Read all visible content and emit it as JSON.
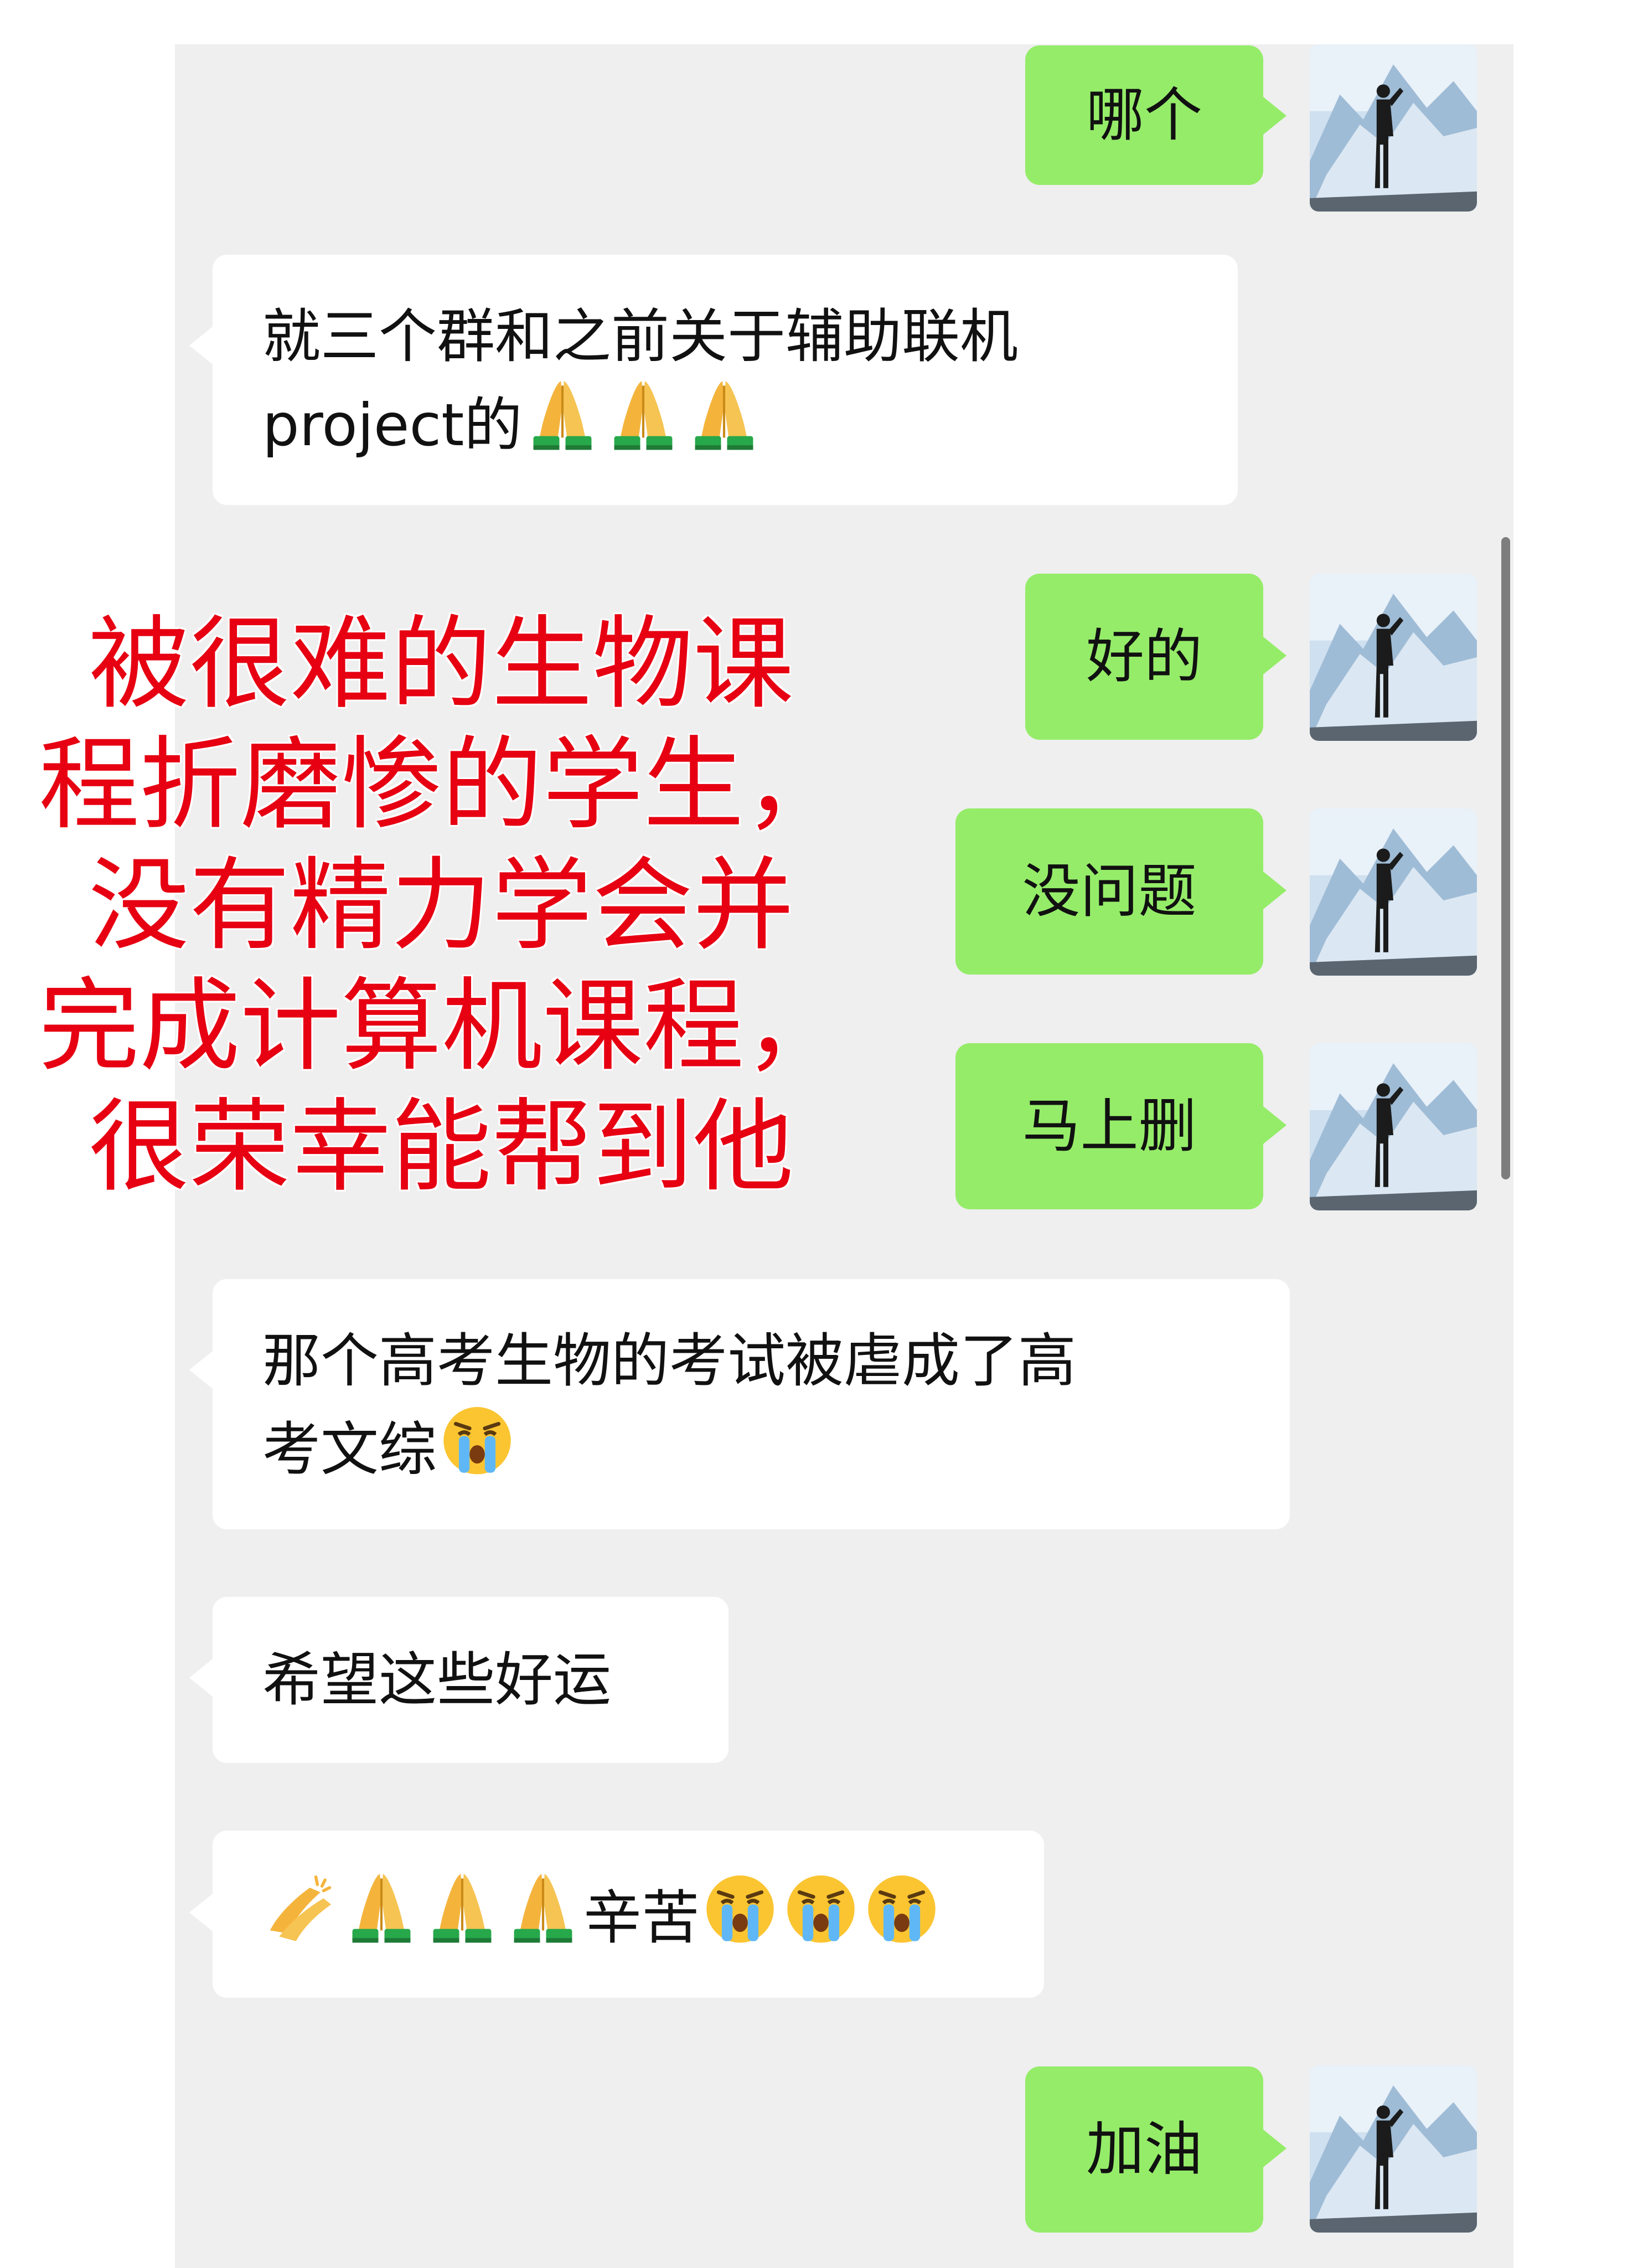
{
  "messages": [
    {
      "id": "m1",
      "side": "out",
      "text": "哪个"
    },
    {
      "id": "m2",
      "side": "in",
      "lines": [
        "就三个群和之前关于辅助联机",
        "project的"
      ],
      "trailing_emojis": [
        "pray",
        "pray",
        "pray"
      ]
    },
    {
      "id": "m3",
      "side": "out",
      "text": "好的"
    },
    {
      "id": "m4",
      "side": "out",
      "text": "没问题"
    },
    {
      "id": "m5",
      "side": "out",
      "text": "马上删"
    },
    {
      "id": "m6",
      "side": "in",
      "lines": [
        "那个高考生物的考试被虐成了高",
        "考文综"
      ],
      "trailing_emojis": [
        "crying-face"
      ]
    },
    {
      "id": "m7",
      "side": "in",
      "lines": [
        "希望这些好运"
      ]
    },
    {
      "id": "m8",
      "side": "in",
      "leading_emojis": [
        "clapping-hands",
        "pray",
        "pray",
        "pray"
      ],
      "lines": [
        "辛苦"
      ],
      "trailing_emojis": [
        "crying-face",
        "crying-face",
        "crying-face"
      ]
    },
    {
      "id": "m9",
      "side": "out",
      "text": "加油"
    }
  ],
  "overlay_caption": {
    "lines": [
      "被很难的生物课",
      "程折磨惨的学生，",
      "没有精力学会并",
      "完成计算机课程，",
      "很荣幸能帮到他"
    ],
    "color": "#e60012"
  },
  "colors": {
    "outgoing_bubble": "#95ec69",
    "incoming_bubble": "#ffffff",
    "chat_background": "#efefef"
  },
  "icons": {
    "avatar": "mountain-hiker-avatar",
    "pray": "folded-hands-emoji",
    "crying": "loudly-crying-face-emoji",
    "clap": "clapping-hands-emoji"
  }
}
